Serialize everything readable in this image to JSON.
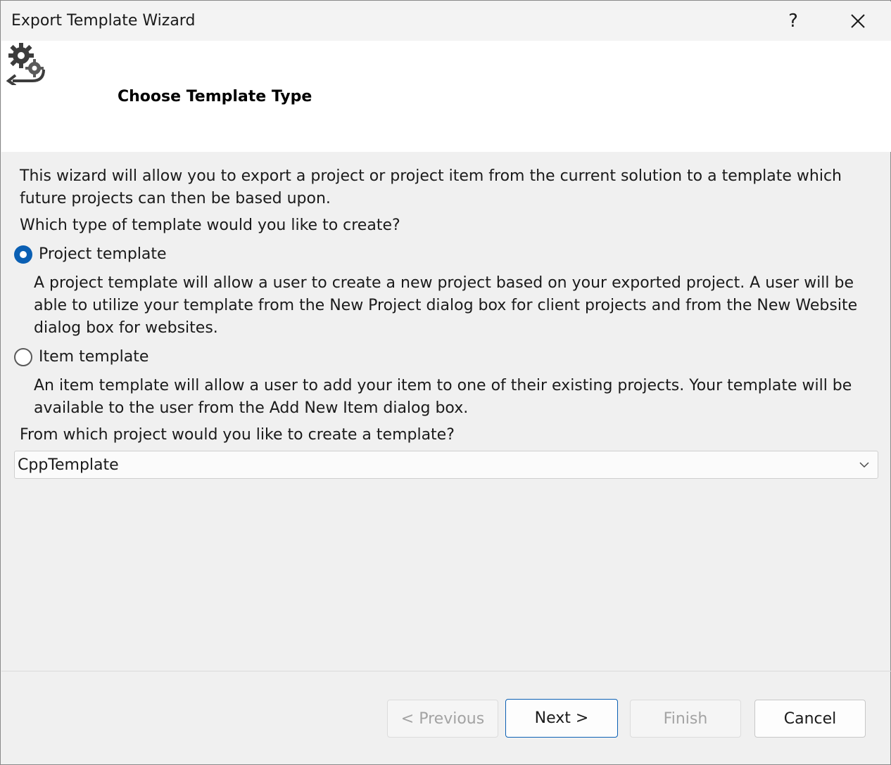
{
  "window": {
    "title": "Export Template Wizard",
    "help_label": "?",
    "close_label": "✕"
  },
  "banner": {
    "icon": "gear-arrow-icon",
    "title": "Choose Template Type"
  },
  "content": {
    "intro": "This wizard will allow you to export a project or project item from the current solution to a template which future projects can then be based upon.",
    "question_type": "Which type of template would you like to create?",
    "options": [
      {
        "label": "Project template",
        "checked": true,
        "description": "A project template will allow a user to create a new project based on your exported project. A user will be able to utilize your template from the New Project dialog box for client projects and from the New Website dialog box for websites."
      },
      {
        "label": "Item template",
        "checked": false,
        "description": "An item template will allow a user to add your item to one of their existing projects. Your template will be available to the user from the Add New Item dialog box."
      }
    ],
    "question_project": "From which project would you like to create a template?",
    "project_select": {
      "value": "CppTemplate"
    }
  },
  "buttons": {
    "previous": "< Previous",
    "next": "Next >",
    "finish": "Finish",
    "cancel": "Cancel"
  },
  "colors": {
    "accent": "#0a5fb3",
    "window_bg": "#f0f0f0",
    "banner_bg": "#ffffff",
    "disabled_text": "#a3a3a3"
  }
}
